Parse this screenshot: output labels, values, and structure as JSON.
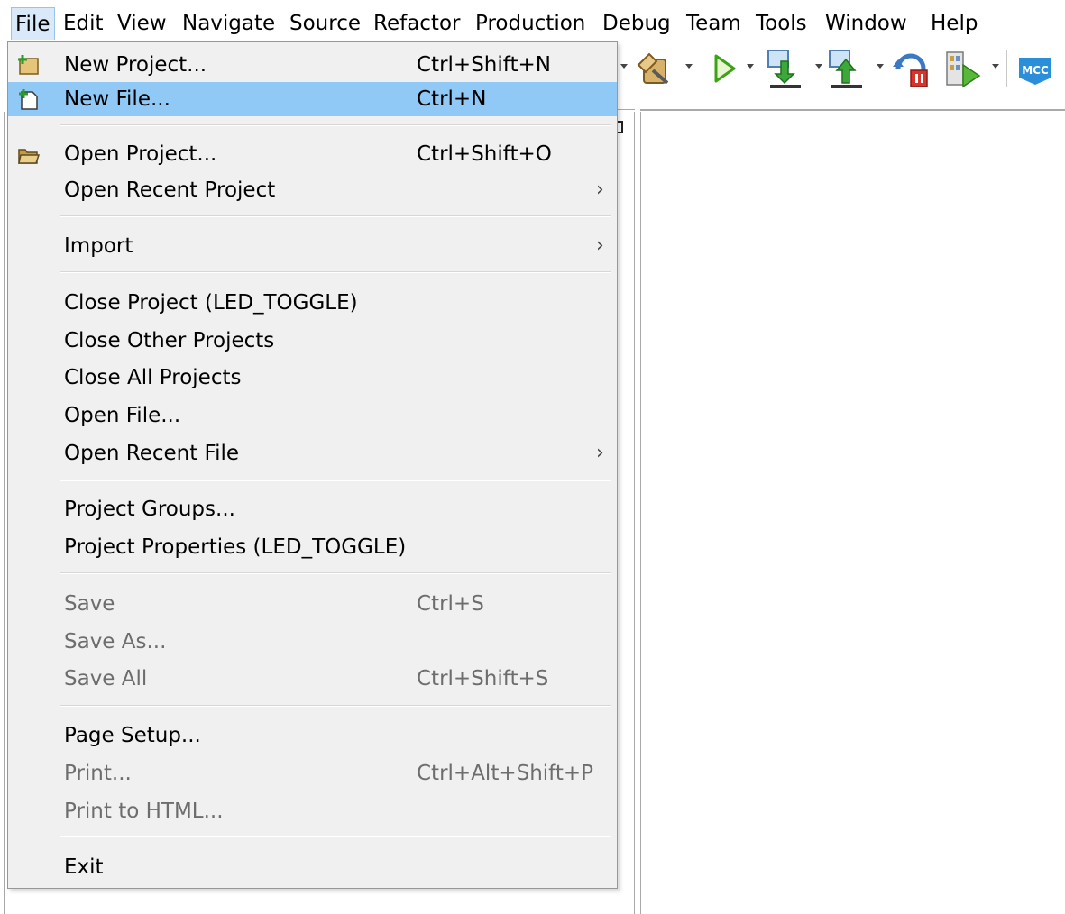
{
  "menubar": {
    "items": [
      "File",
      "Edit",
      "View",
      "Navigate",
      "Source",
      "Refactor",
      "Production",
      "Debug",
      "Team",
      "Tools",
      "Window",
      "Help"
    ]
  },
  "toolbar": {
    "icons": [
      "clean-build-icon",
      "run-icon",
      "program-device-icon",
      "read-device-icon",
      "hold-reset-icon",
      "debug-main-icon",
      "mcc-icon"
    ],
    "mcc_label": "MCC"
  },
  "file_menu": {
    "new_project": {
      "label": "New Project...",
      "shortcut": "Ctrl+Shift+N"
    },
    "new_file": {
      "label": "New File...",
      "shortcut": "Ctrl+N"
    },
    "open_project": {
      "label": "Open Project...",
      "shortcut": "Ctrl+Shift+O"
    },
    "open_recent_project": {
      "label": "Open Recent Project",
      "arrow": "›"
    },
    "import": {
      "label": "Import",
      "arrow": "›"
    },
    "close_project": {
      "label": "Close Project (LED_TOGGLE)"
    },
    "close_other_projects": {
      "label": "Close Other Projects"
    },
    "close_all_projects": {
      "label": "Close All Projects"
    },
    "open_file": {
      "label": "Open File..."
    },
    "open_recent_file": {
      "label": "Open Recent File",
      "arrow": "›"
    },
    "project_groups": {
      "label": "Project Groups..."
    },
    "project_properties": {
      "label": "Project Properties (LED_TOGGLE)"
    },
    "save": {
      "label": "Save",
      "shortcut": "Ctrl+S"
    },
    "save_as": {
      "label": "Save As..."
    },
    "save_all": {
      "label": "Save All",
      "shortcut": "Ctrl+Shift+S"
    },
    "page_setup": {
      "label": "Page Setup..."
    },
    "print": {
      "label": "Print...",
      "shortcut": "Ctrl+Alt+Shift+P"
    },
    "print_to_html": {
      "label": "Print to HTML..."
    },
    "exit": {
      "label": "Exit"
    }
  },
  "colors": {
    "highlight": "#90c8f6",
    "menu_bg": "#f0f0f0",
    "disabled_text": "#6d6d6d",
    "mcc_badge": "#2a8fd8"
  }
}
